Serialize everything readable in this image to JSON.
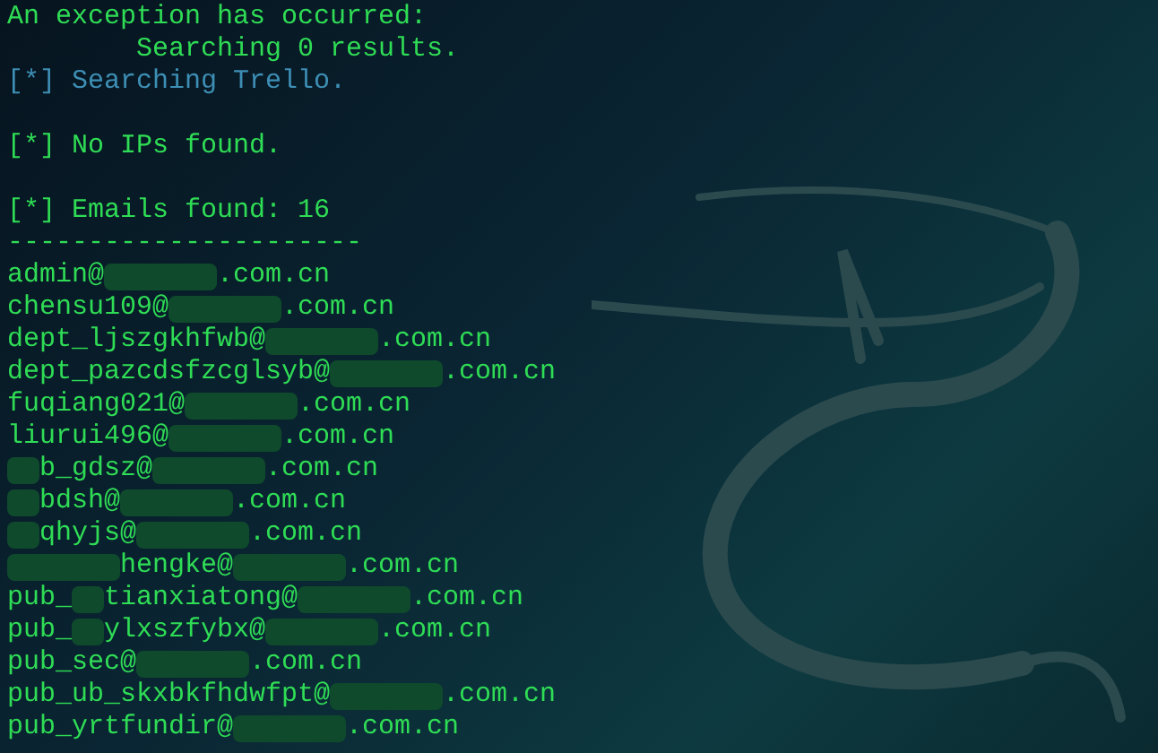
{
  "lines": [
    {
      "kind": "plain",
      "text": "An exception has occurred:"
    },
    {
      "kind": "plain",
      "text": "        Searching 0 results."
    },
    {
      "kind": "info",
      "text": "[*] Searching Trello."
    },
    {
      "kind": "blank"
    },
    {
      "kind": "plain",
      "text": "[*] No IPs found."
    },
    {
      "kind": "blank"
    },
    {
      "kind": "plain",
      "text": "[*] Emails found: 16"
    },
    {
      "kind": "plain",
      "text": "----------------------"
    }
  ],
  "emails": [
    {
      "parts": [
        {
          "kind": "text",
          "text": "admin@"
        },
        {
          "kind": "redaction"
        },
        {
          "kind": "text",
          "text": ".com.cn"
        }
      ]
    },
    {
      "parts": [
        {
          "kind": "text",
          "text": "chensu109@"
        },
        {
          "kind": "redaction"
        },
        {
          "kind": "text",
          "text": ".com.cn"
        }
      ]
    },
    {
      "parts": [
        {
          "kind": "text",
          "text": "dept_ljszgkhfwb@"
        },
        {
          "kind": "redaction"
        },
        {
          "kind": "text",
          "text": ".com.cn"
        }
      ]
    },
    {
      "parts": [
        {
          "kind": "text",
          "text": "dept_pazcdsfzcglsyb@"
        },
        {
          "kind": "redaction"
        },
        {
          "kind": "text",
          "text": ".com.cn"
        }
      ]
    },
    {
      "parts": [
        {
          "kind": "text",
          "text": "fuqiang021@"
        },
        {
          "kind": "redaction"
        },
        {
          "kind": "text",
          "text": ".com.cn"
        }
      ]
    },
    {
      "parts": [
        {
          "kind": "text",
          "text": "liurui496@"
        },
        {
          "kind": "redaction"
        },
        {
          "kind": "text",
          "text": ".com.cn"
        }
      ]
    },
    {
      "parts": [
        {
          "kind": "redaction_short"
        },
        {
          "kind": "text",
          "text": "b_gdsz@"
        },
        {
          "kind": "redaction"
        },
        {
          "kind": "text",
          "text": ".com.cn"
        }
      ]
    },
    {
      "parts": [
        {
          "kind": "redaction_short"
        },
        {
          "kind": "text",
          "text": "bdsh@"
        },
        {
          "kind": "redaction"
        },
        {
          "kind": "text",
          "text": ".com.cn"
        }
      ]
    },
    {
      "parts": [
        {
          "kind": "redaction_short"
        },
        {
          "kind": "text",
          "text": "qhyjs@"
        },
        {
          "kind": "redaction"
        },
        {
          "kind": "text",
          "text": ".com.cn"
        }
      ]
    },
    {
      "parts": [
        {
          "kind": "redaction"
        },
        {
          "kind": "text",
          "text": "hengke@"
        },
        {
          "kind": "redaction"
        },
        {
          "kind": "text",
          "text": ".com.cn"
        }
      ]
    },
    {
      "parts": [
        {
          "kind": "text",
          "text": "pub_"
        },
        {
          "kind": "redaction_short"
        },
        {
          "kind": "text",
          "text": "tianxiatong@"
        },
        {
          "kind": "redaction"
        },
        {
          "kind": "text",
          "text": ".com.cn"
        }
      ]
    },
    {
      "parts": [
        {
          "kind": "text",
          "text": "pub_"
        },
        {
          "kind": "redaction_short"
        },
        {
          "kind": "text",
          "text": "ylxszfybx@"
        },
        {
          "kind": "redaction"
        },
        {
          "kind": "text",
          "text": ".com.cn"
        }
      ]
    },
    {
      "parts": [
        {
          "kind": "text",
          "text": "pub_sec@"
        },
        {
          "kind": "redaction"
        },
        {
          "kind": "text",
          "text": ".com.cn"
        }
      ]
    },
    {
      "parts": [
        {
          "kind": "text",
          "text": "pub_ub_skxbkfhdwfpt@"
        },
        {
          "kind": "redaction"
        },
        {
          "kind": "text",
          "text": ".com.cn"
        }
      ]
    },
    {
      "parts": [
        {
          "kind": "text",
          "text": "pub_yrtfundir@"
        },
        {
          "kind": "redaction"
        },
        {
          "kind": "text",
          "text": ".com.cn"
        }
      ]
    }
  ]
}
